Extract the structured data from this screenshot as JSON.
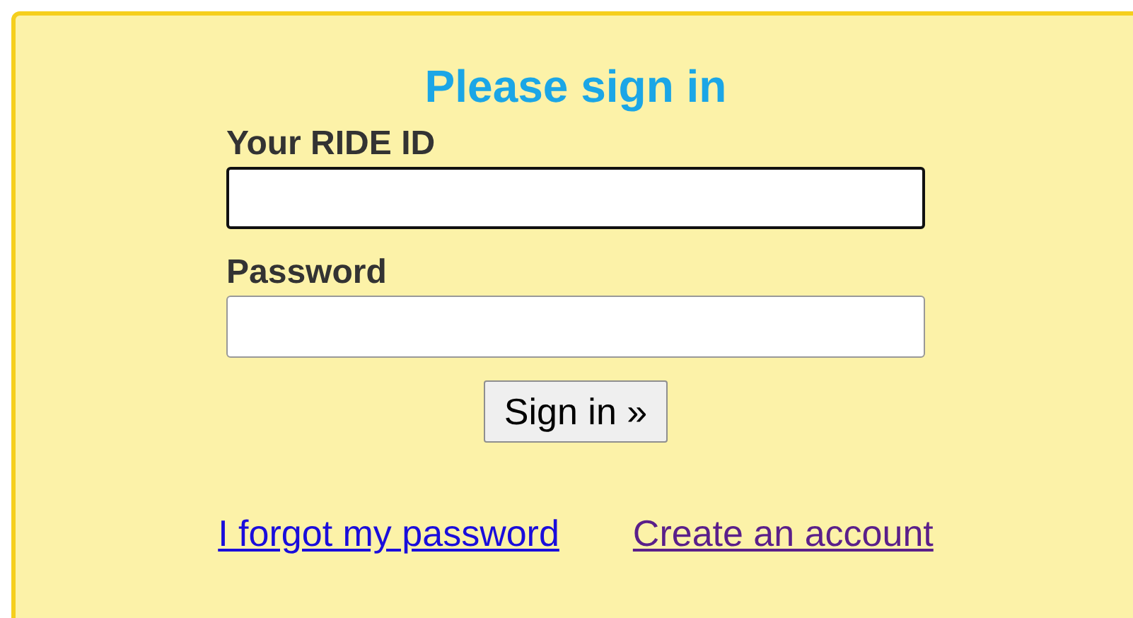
{
  "title": "Please sign in",
  "fields": [
    {
      "label": "Your RIDE ID",
      "focused": true
    },
    {
      "label": "Password",
      "focused": false
    }
  ],
  "button": "Sign in »",
  "links": [
    {
      "text": "I forgot my password",
      "visited": false
    },
    {
      "text": "Create an account",
      "visited": true
    }
  ]
}
